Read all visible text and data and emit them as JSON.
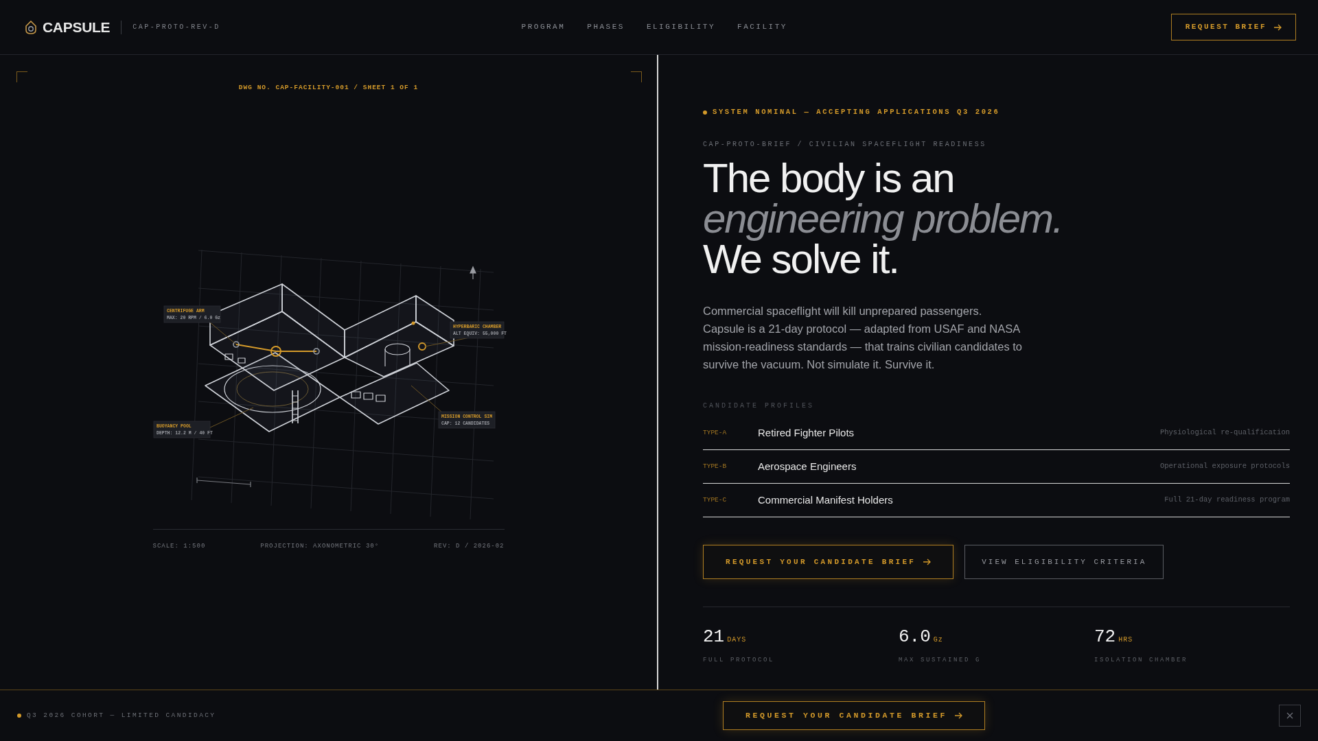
{
  "header": {
    "logo": "CAPSULE",
    "code": "CAP-PROTO-REV-D",
    "nav": [
      "PROGRAM",
      "PHASES",
      "ELIGIBILITY",
      "FACILITY"
    ],
    "cta": "REQUEST BRIEF"
  },
  "drawing": {
    "sheet": "DWG NO. CAP-FACILITY-001 / SHEET 1 OF 1",
    "callouts": [
      {
        "title": "CENTRIFUGE ARM",
        "detail": "MAX: 20 RPM / 6.0 Gz"
      },
      {
        "title": "HYPERBARIC CHAMBER",
        "detail": "ALT EQUIV: 55,000 FT"
      },
      {
        "title": "BUOYANCY POOL",
        "detail": "DEPTH: 12.2 M / 40 FT"
      },
      {
        "title": "MISSION CONTROL SIM",
        "detail": "CAP: 12 CANDIDATES"
      }
    ],
    "meta": [
      "SCALE: 1:500",
      "PROJECTION: AXONOMETRIC 30°",
      "REV: D / 2026-02"
    ]
  },
  "hero": {
    "status": "SYSTEM NOMINAL — ACCEPTING APPLICATIONS Q3 2026",
    "eyebrow": "CAP-PROTO-BRIEF / CIVILIAN SPACEFLIGHT READINESS",
    "headline": [
      {
        "text": "The body is an",
        "kind": "plain"
      },
      {
        "text": "engineering problem.",
        "kind": "accent"
      },
      {
        "text": "We solve it.",
        "kind": "plain"
      }
    ],
    "lede": "Commercial spaceflight will kill unprepared passengers. Capsule is a 21-day protocol — adapted from USAF and NASA mission-readiness standards — that trains civilian candidates to survive the vacuum. Not simulate it. Survive it.",
    "profiles_title": "CANDIDATE PROFILES",
    "profiles": [
      {
        "type": "TYPE-A",
        "name": "Retired Fighter Pilots",
        "note": "Physiological re-qualification"
      },
      {
        "type": "TYPE-B",
        "name": "Aerospace Engineers",
        "note": "Operational exposure protocols"
      },
      {
        "type": "TYPE-C",
        "name": "Commercial Manifest Holders",
        "note": "Full 21-day readiness program"
      }
    ],
    "primary_button": "REQUEST YOUR CANDIDATE BRIEF",
    "secondary_button": "VIEW ELIGIBILITY CRITERIA",
    "stats": [
      {
        "value": "21",
        "unit": "DAYS",
        "label": "FULL PROTOCOL"
      },
      {
        "value": "6.0",
        "unit": "Gz",
        "label": "MAX SUSTAINED G"
      },
      {
        "value": "72",
        "unit": "HRS",
        "label": "ISOLATION CHAMBER"
      }
    ]
  },
  "footer": {
    "note": "Q3 2026 COHORT — LIMITED CANDIDACY",
    "cta": "REQUEST YOUR CANDIDATE BRIEF"
  }
}
